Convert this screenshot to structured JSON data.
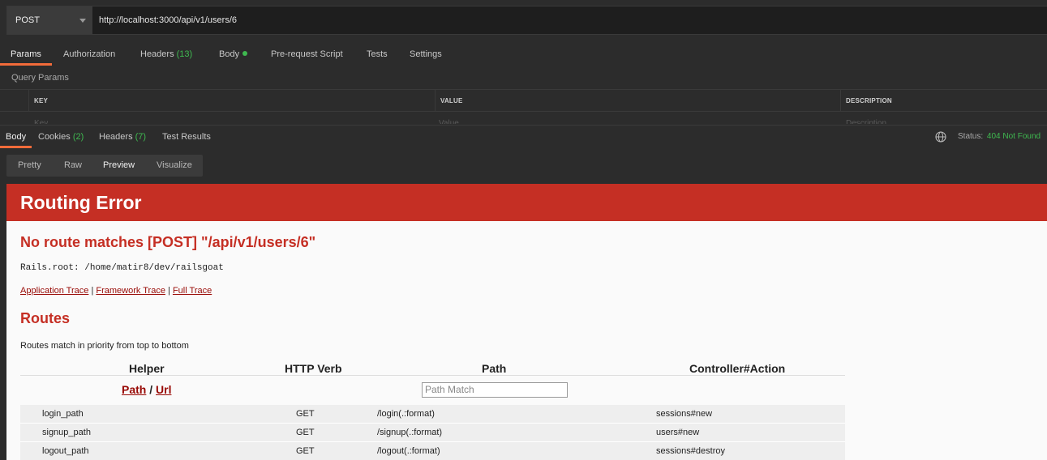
{
  "request": {
    "method": "POST",
    "url": "http://localhost:3000/api/v1/users/6"
  },
  "request_tabs": [
    {
      "label": "Params",
      "count": ""
    },
    {
      "label": "Authorization",
      "count": ""
    },
    {
      "label": "Headers",
      "count": "(13)"
    },
    {
      "label": "Body",
      "count": ""
    },
    {
      "label": "Pre-request Script",
      "count": ""
    },
    {
      "label": "Tests",
      "count": ""
    },
    {
      "label": "Settings",
      "count": ""
    }
  ],
  "query_params": {
    "title": "Query Params",
    "headers": {
      "key": "KEY",
      "value": "VALUE",
      "description": "DESCRIPTION"
    },
    "placeholders": {
      "key": "Key",
      "value": "Value",
      "description": "Description"
    }
  },
  "response_tabs": [
    {
      "label": "Body",
      "count": ""
    },
    {
      "label": "Cookies",
      "count": "(2)"
    },
    {
      "label": "Headers",
      "count": "(7)"
    },
    {
      "label": "Test Results",
      "count": ""
    }
  ],
  "status": {
    "label": "Status:",
    "value": "404 Not Found"
  },
  "view_tabs": [
    "Pretty",
    "Raw",
    "Preview",
    "Visualize"
  ],
  "colors": {
    "accent": "#f26b3a",
    "success": "#3fb950",
    "rails_red": "#c52f24"
  },
  "preview": {
    "banner": "Routing Error",
    "error": "No route matches [POST] \"/api/v1/users/6\"",
    "rails_root": "Rails.root: /home/matir8/dev/railsgoat",
    "trace_links": [
      "Application Trace",
      "Framework Trace",
      "Full Trace"
    ],
    "trace_sep": "|",
    "routes_title": "Routes",
    "routes_desc": "Routes match in priority from top to bottom",
    "table_headers": [
      "Helper",
      "HTTP Verb",
      "Path",
      "Controller#Action"
    ],
    "path_link": "Path",
    "path_sep": "/",
    "url_link": "Url",
    "path_match_placeholder": "Path Match",
    "routes": [
      {
        "helper": "login_path",
        "verb": "GET",
        "path": "/login(.:format)",
        "action": "sessions#new"
      },
      {
        "helper": "signup_path",
        "verb": "GET",
        "path": "/signup(.:format)",
        "action": "users#new"
      },
      {
        "helper": "logout_path",
        "verb": "GET",
        "path": "/logout(.:format)",
        "action": "sessions#destroy"
      }
    ]
  }
}
